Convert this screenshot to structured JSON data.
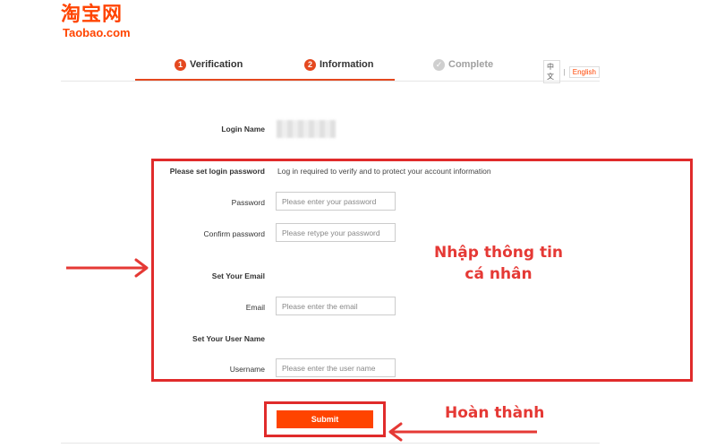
{
  "logo": {
    "chinese": "淘宝网",
    "latin": "Taobao.com"
  },
  "steps": [
    {
      "number": "1",
      "label": "Verification"
    },
    {
      "number": "2",
      "label": "Information"
    },
    {
      "number": "✓",
      "label": "Complete"
    }
  ],
  "language": {
    "chinese": "中文",
    "english": "English"
  },
  "form": {
    "login_name_label": "Login Name",
    "password_section_title": "Please set login password",
    "password_info": "Log in required to verify and to protect your account information",
    "password_label": "Password",
    "password_placeholder": "Please enter your password",
    "confirm_label": "Confirm password",
    "confirm_placeholder": "Please retype your password",
    "email_section_title": "Set Your Email",
    "email_label": "Email",
    "email_placeholder": "Please enter the email",
    "username_section_title": "Set Your User Name",
    "username_label": "Username",
    "username_placeholder": "Please enter the user name",
    "submit_label": "Submit"
  },
  "annotations": {
    "enter_info": "Nhập thông tin cá nhân",
    "done": "Hoàn thành",
    "color": "#e53935"
  },
  "colors": {
    "brand": "#ff4400",
    "step_active": "#e4481f",
    "annotation_border": "#e02b2b"
  }
}
